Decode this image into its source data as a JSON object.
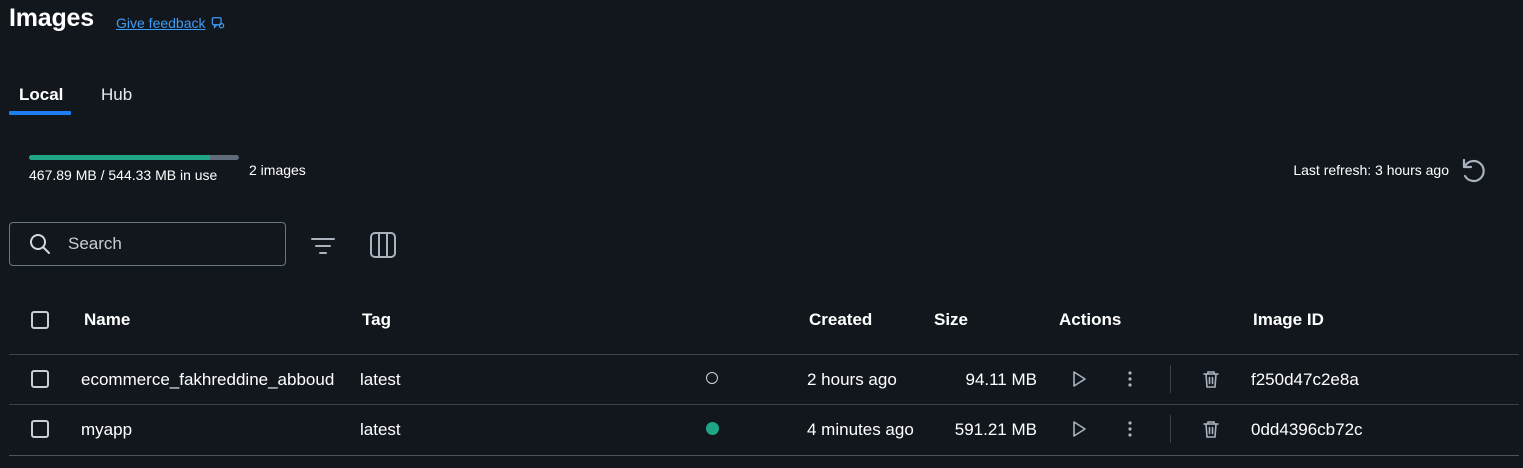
{
  "header": {
    "title": "Images",
    "feedback_link": "Give feedback"
  },
  "tabs": [
    {
      "label": "Local",
      "active": true
    },
    {
      "label": "Hub",
      "active": false
    }
  ],
  "usage": {
    "text": "467.89 MB / 544.33 MB in use",
    "fraction": 0.8596,
    "images_count": "2 images",
    "colors": {
      "used": "#1ea686",
      "remaining": "#5f6b7a"
    }
  },
  "refresh": {
    "text": "Last refresh: 3 hours ago",
    "icon": "refresh-icon"
  },
  "search": {
    "placeholder": "Search",
    "value": ""
  },
  "table": {
    "headers": {
      "name": "Name",
      "tag": "Tag",
      "created": "Created",
      "size": "Size",
      "actions": "Actions",
      "image_id": "Image ID"
    },
    "rows": [
      {
        "name": "ecommerce_fakhreddine_abboud",
        "tag": "latest",
        "in_use": false,
        "created": "2 hours ago",
        "size": "94.11 MB",
        "image_id": "f250d47c2e8a"
      },
      {
        "name": "myapp",
        "tag": "latest",
        "in_use": true,
        "created": "4 minutes ago",
        "size": "591.21 MB",
        "image_id": "0dd4396cb72c"
      }
    ]
  },
  "accent_color": "#1d7ff2"
}
